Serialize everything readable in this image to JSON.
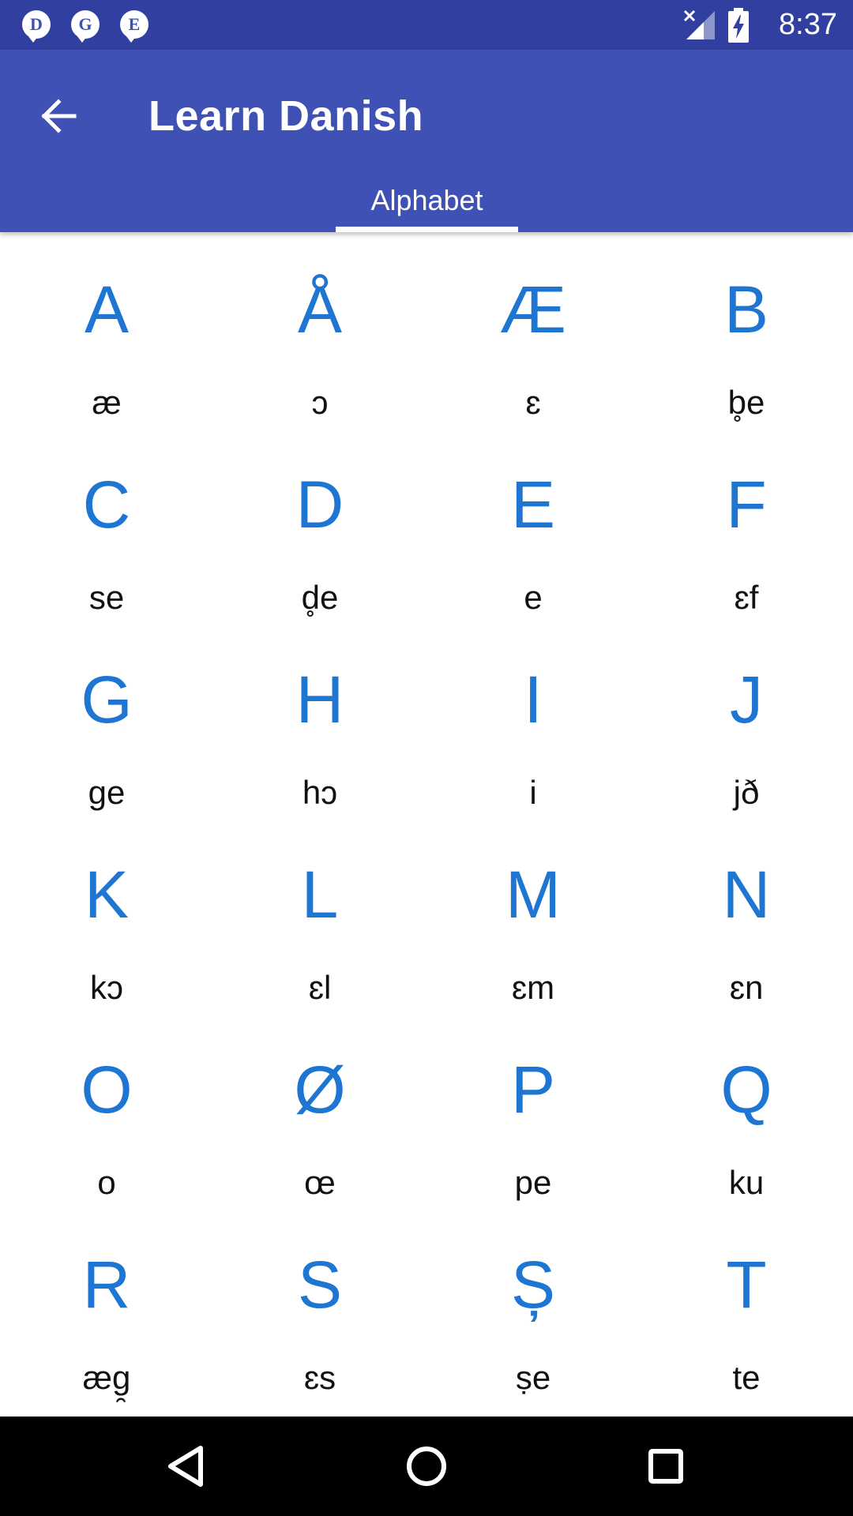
{
  "status_bar": {
    "notifications": [
      {
        "letter": "D",
        "icon": "notification-d-icon"
      },
      {
        "letter": "G",
        "icon": "notification-g-icon"
      },
      {
        "letter": "E",
        "icon": "notification-e-icon"
      }
    ],
    "signal_icon": "no-signal-icon",
    "battery_icon": "battery-charging-icon",
    "time": "8:37"
  },
  "app_bar": {
    "back_icon": "arrow-back-icon",
    "title": "Learn Danish",
    "tabs": [
      {
        "label": "Alphabet",
        "selected": true
      }
    ]
  },
  "letters": [
    {
      "letter": "A",
      "pronunciation": "æ"
    },
    {
      "letter": "Å",
      "pronunciation": "ɔ"
    },
    {
      "letter": "Æ",
      "pronunciation": "ɛ"
    },
    {
      "letter": "B",
      "pronunciation": "b̥e"
    },
    {
      "letter": "C",
      "pronunciation": "se"
    },
    {
      "letter": "D",
      "pronunciation": "d̥e"
    },
    {
      "letter": "E",
      "pronunciation": "e"
    },
    {
      "letter": "F",
      "pronunciation": "ɛf"
    },
    {
      "letter": "G",
      "pronunciation": "ge"
    },
    {
      "letter": "H",
      "pronunciation": "hɔ"
    },
    {
      "letter": "I",
      "pronunciation": "i"
    },
    {
      "letter": "J",
      "pronunciation": "jð"
    },
    {
      "letter": "K",
      "pronunciation": "kɔ"
    },
    {
      "letter": "L",
      "pronunciation": "ɛl"
    },
    {
      "letter": "M",
      "pronunciation": "ɛm"
    },
    {
      "letter": "N",
      "pronunciation": "ɛn"
    },
    {
      "letter": "O",
      "pronunciation": "o"
    },
    {
      "letter": "Ø",
      "pronunciation": "œ"
    },
    {
      "letter": "P",
      "pronunciation": "pe"
    },
    {
      "letter": "Q",
      "pronunciation": "ku"
    },
    {
      "letter": "R",
      "pronunciation": "æg̯"
    },
    {
      "letter": "S",
      "pronunciation": "ɛs"
    },
    {
      "letter": "Ș",
      "pronunciation": "ṣe"
    },
    {
      "letter": "T",
      "pronunciation": "te"
    }
  ],
  "colors": {
    "status_bar": "#3140a0",
    "app_bar": "#3f51b5",
    "letter_accent": "#1e76d2",
    "nav_bar": "#000000"
  },
  "nav_bar": {
    "back_icon": "nav-back-triangle-icon",
    "home_icon": "nav-home-circle-icon",
    "recents_icon": "nav-recents-square-icon"
  }
}
